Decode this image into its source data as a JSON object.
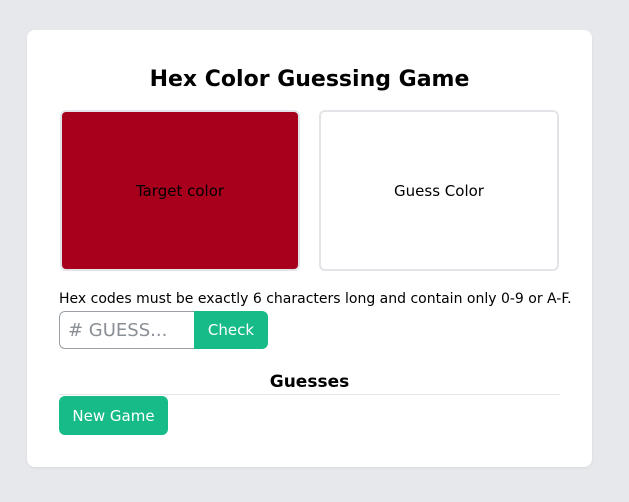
{
  "game": {
    "title": "Hex Color Guessing Game",
    "target_label": "Target color",
    "target_color": "#a8001c",
    "guess_label": "Guess Color",
    "hint": "Hex codes must be exactly 6 characters long and contain only 0-9 or A-F.",
    "input_placeholder": "# GUESS...",
    "check_label": "Check",
    "guesses_heading": "Guesses",
    "new_game_label": "New Game"
  },
  "colors": {
    "accent": "#17bb87",
    "background": "#e6e8eb"
  }
}
